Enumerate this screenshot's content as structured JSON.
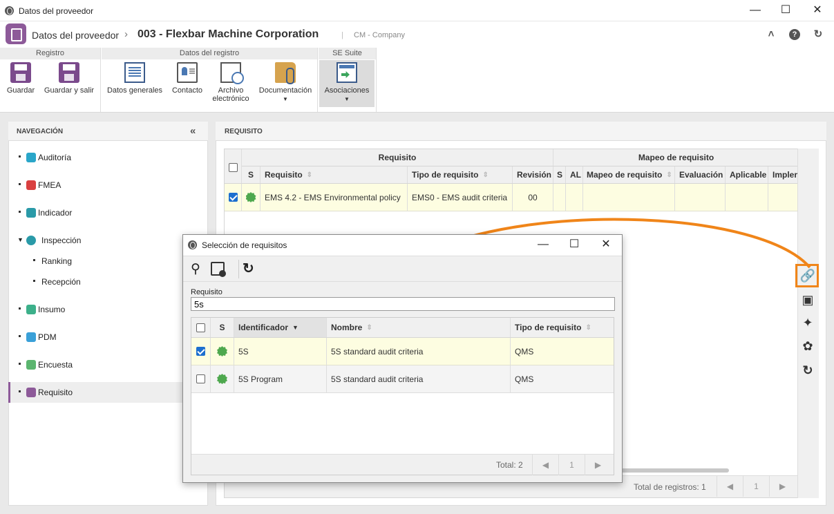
{
  "window": {
    "title": "Datos del proveedor"
  },
  "header": {
    "breadcrumb_root": "Datos del proveedor",
    "record": "003 - Flexbar Machine Corporation",
    "separator": "|",
    "company": "CM - Company"
  },
  "ribbon": {
    "groups": [
      "Registro",
      "Datos del registro",
      "SE Suite"
    ],
    "buttons": {
      "guardar": "Guardar",
      "guardar_salir": "Guardar y salir",
      "datos_generales": "Datos generales",
      "contacto": "Contacto",
      "archivo_1": "Archivo",
      "archivo_2": "electrónico",
      "documentacion": "Documentación",
      "asociaciones": "Asociaciones"
    }
  },
  "nav": {
    "title": "NAVEGACIÓN",
    "items": [
      {
        "label": "Auditoría",
        "color": "#2aa6c9"
      },
      {
        "label": "FMEA",
        "color": "#d94040"
      },
      {
        "label": "Indicador",
        "color": "#2a9aa8"
      },
      {
        "label": "Inspección",
        "color": "#2a9aa8"
      },
      {
        "label": "Ranking"
      },
      {
        "label": "Recepción"
      },
      {
        "label": "Insumo",
        "color": "#3cb08a"
      },
      {
        "label": "PDM",
        "color": "#3aa0d8"
      },
      {
        "label": "Encuesta",
        "color": "#5bb56f"
      },
      {
        "label": "Requisito",
        "color": "#8d5a99"
      }
    ]
  },
  "main": {
    "title": "REQUISITO",
    "group_headers": [
      "Requisito",
      "Mapeo de requisito"
    ],
    "columns": [
      "S",
      "Requisito",
      "Tipo de requisito",
      "Revisión",
      "S",
      "AL",
      "Mapeo de requisito",
      "Evaluación",
      "Aplicable",
      "Implen"
    ],
    "rows": [
      {
        "requisito": "EMS 4.2 - EMS Environmental policy",
        "tipo": "EMS0 - EMS audit criteria",
        "revision": "00"
      }
    ],
    "footer": {
      "total": "Total de registros: 1",
      "page": "1"
    }
  },
  "dialog": {
    "title": "Selección de requisitos",
    "field_label": "Requisito",
    "field_value": "5s",
    "columns": [
      "S",
      "Identificador",
      "Nombre",
      "Tipo de requisito"
    ],
    "rows": [
      {
        "checked": true,
        "id": "5S",
        "nombre": "5S standard audit criteria",
        "tipo": "QMS"
      },
      {
        "checked": false,
        "id": "5S Program",
        "nombre": "5S standard audit criteria",
        "tipo": "QMS"
      }
    ],
    "footer": {
      "total": "Total: 2",
      "page": "1"
    }
  },
  "colors": {
    "accent": "#8d5a99",
    "highlight": "#f08519",
    "selected_row": "#fdfde1",
    "check_blue": "#1d6fcf",
    "badge_green": "#4ea84e"
  }
}
